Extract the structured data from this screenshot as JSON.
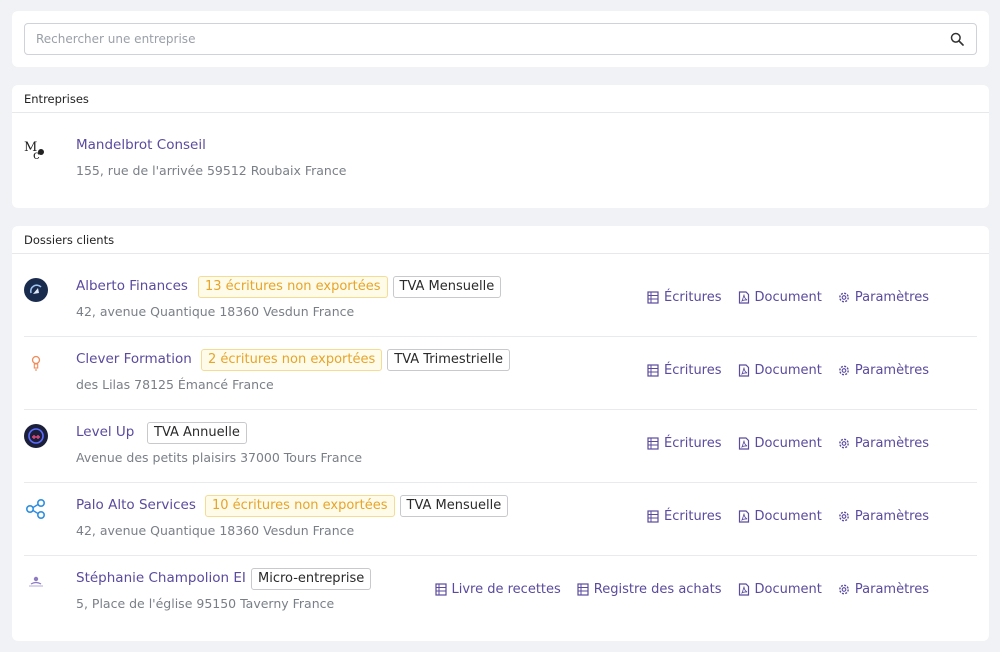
{
  "search": {
    "placeholder": "Rechercher une entreprise"
  },
  "entreprises": {
    "title": "Entreprises",
    "items": [
      {
        "name": "Mandelbrot Conseil",
        "address": "155, rue de l'arrivée 59512 Roubaix France"
      }
    ]
  },
  "dossiers": {
    "title": "Dossiers clients",
    "items": [
      {
        "name": "Alberto Finances",
        "address": "42, avenue Quantique 18360 Vesdun France",
        "badge_warn": "13 écritures non exportées",
        "badge_tva": "TVA Mensuelle",
        "actions": [
          "Écritures",
          "Document",
          "Paramètres"
        ]
      },
      {
        "name": "Clever Formation",
        "address": "des Lilas 78125 Émancé France",
        "badge_warn": "2 écritures non exportées",
        "badge_tva": "TVA Trimestrielle",
        "actions": [
          "Écritures",
          "Document",
          "Paramètres"
        ]
      },
      {
        "name": "Level Up",
        "address": "Avenue des petits plaisirs 37000 Tours France",
        "badge_tva": "TVA Annuelle",
        "actions": [
          "Écritures",
          "Document",
          "Paramètres"
        ]
      },
      {
        "name": "Palo Alto Services",
        "address": "42, avenue Quantique 18360 Vesdun France",
        "badge_warn": "10 écritures non exportées",
        "badge_tva": "TVA Mensuelle",
        "actions": [
          "Écritures",
          "Document",
          "Paramètres"
        ]
      },
      {
        "name": "Stéphanie Champolion EI",
        "address": "5, Place de l'église 95150 Taverny France",
        "badge_tva": "Micro-entreprise",
        "actions": [
          "Livre de recettes",
          "Registre des achats",
          "Document",
          "Paramètres"
        ]
      }
    ]
  },
  "colors": {
    "accent": "#5b4a9e",
    "warning_text": "#e6a42a",
    "warning_bg": "#fffbe9",
    "page_bg": "#f1f2f5"
  }
}
